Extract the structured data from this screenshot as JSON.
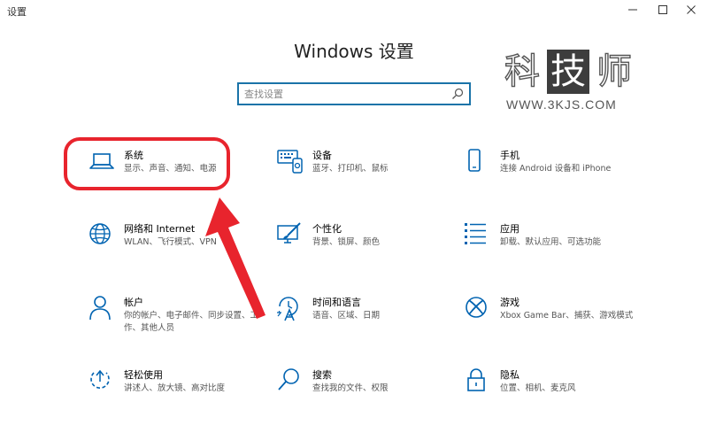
{
  "window": {
    "title": "设置"
  },
  "page": {
    "title": "Windows 设置"
  },
  "search": {
    "placeholder": "查找设置"
  },
  "watermark": {
    "chars": [
      "科",
      "技",
      "师"
    ],
    "url": "WWW.3KJS.COM"
  },
  "tiles": [
    {
      "title": "系统",
      "desc": "显示、声音、通知、电源",
      "icon": "laptop-icon"
    },
    {
      "title": "设备",
      "desc": "蓝牙、打印机、鼠标",
      "icon": "devices-icon"
    },
    {
      "title": "手机",
      "desc": "连接 Android 设备和 iPhone",
      "icon": "phone-icon"
    },
    {
      "title": "网络和 Internet",
      "desc": "WLAN、飞行模式、VPN",
      "icon": "globe-icon"
    },
    {
      "title": "个性化",
      "desc": "背景、锁屏、颜色",
      "icon": "personalization-icon"
    },
    {
      "title": "应用",
      "desc": "卸载、默认应用、可选功能",
      "icon": "apps-list-icon"
    },
    {
      "title": "帐户",
      "desc": "你的帐户、电子邮件、同步设置、工作、其他人员",
      "icon": "person-icon"
    },
    {
      "title": "时间和语言",
      "desc": "语音、区域、日期",
      "icon": "time-language-icon"
    },
    {
      "title": "游戏",
      "desc": "Xbox Game Bar、捕获、游戏模式",
      "icon": "xbox-icon"
    },
    {
      "title": "轻松使用",
      "desc": "讲述人、放大镜、高对比度",
      "icon": "ease-of-access-icon"
    },
    {
      "title": "搜索",
      "desc": "查找我的文件、权限",
      "icon": "search-icon"
    },
    {
      "title": "隐私",
      "desc": "位置、相机、麦克风",
      "icon": "lock-icon"
    }
  ],
  "colors": {
    "accent": "#0063b1",
    "annotation": "#e8242d"
  }
}
